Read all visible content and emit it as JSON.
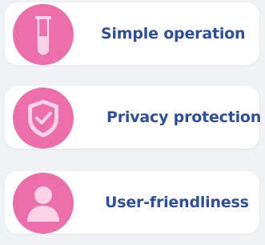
{
  "colors": {
    "accent": "#ec6fab",
    "text": "#2e4fa0",
    "card": "#ffffff",
    "background": "#f1f2f6"
  },
  "features": [
    {
      "label": "Simple operation",
      "icon": "test-tube-icon"
    },
    {
      "label": "Privacy protection",
      "icon": "shield-check-icon"
    },
    {
      "label": "User-friendliness",
      "icon": "user-icon"
    }
  ]
}
